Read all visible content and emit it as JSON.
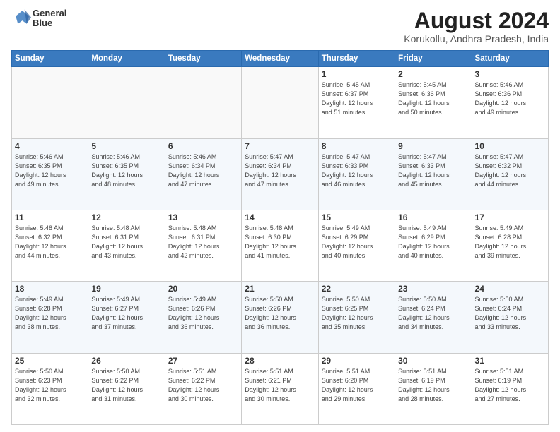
{
  "header": {
    "logo_line1": "General",
    "logo_line2": "Blue",
    "title": "August 2024",
    "subtitle": "Korukollu, Andhra Pradesh, India"
  },
  "calendar": {
    "headers": [
      "Sunday",
      "Monday",
      "Tuesday",
      "Wednesday",
      "Thursday",
      "Friday",
      "Saturday"
    ],
    "weeks": [
      [
        {
          "day": "",
          "info": "",
          "empty": true
        },
        {
          "day": "",
          "info": "",
          "empty": true
        },
        {
          "day": "",
          "info": "",
          "empty": true
        },
        {
          "day": "",
          "info": "",
          "empty": true
        },
        {
          "day": "1",
          "info": "Sunrise: 5:45 AM\nSunset: 6:37 PM\nDaylight: 12 hours\nand 51 minutes."
        },
        {
          "day": "2",
          "info": "Sunrise: 5:45 AM\nSunset: 6:36 PM\nDaylight: 12 hours\nand 50 minutes."
        },
        {
          "day": "3",
          "info": "Sunrise: 5:46 AM\nSunset: 6:36 PM\nDaylight: 12 hours\nand 49 minutes."
        }
      ],
      [
        {
          "day": "4",
          "info": "Sunrise: 5:46 AM\nSunset: 6:35 PM\nDaylight: 12 hours\nand 49 minutes."
        },
        {
          "day": "5",
          "info": "Sunrise: 5:46 AM\nSunset: 6:35 PM\nDaylight: 12 hours\nand 48 minutes."
        },
        {
          "day": "6",
          "info": "Sunrise: 5:46 AM\nSunset: 6:34 PM\nDaylight: 12 hours\nand 47 minutes."
        },
        {
          "day": "7",
          "info": "Sunrise: 5:47 AM\nSunset: 6:34 PM\nDaylight: 12 hours\nand 47 minutes."
        },
        {
          "day": "8",
          "info": "Sunrise: 5:47 AM\nSunset: 6:33 PM\nDaylight: 12 hours\nand 46 minutes."
        },
        {
          "day": "9",
          "info": "Sunrise: 5:47 AM\nSunset: 6:33 PM\nDaylight: 12 hours\nand 45 minutes."
        },
        {
          "day": "10",
          "info": "Sunrise: 5:47 AM\nSunset: 6:32 PM\nDaylight: 12 hours\nand 44 minutes."
        }
      ],
      [
        {
          "day": "11",
          "info": "Sunrise: 5:48 AM\nSunset: 6:32 PM\nDaylight: 12 hours\nand 44 minutes."
        },
        {
          "day": "12",
          "info": "Sunrise: 5:48 AM\nSunset: 6:31 PM\nDaylight: 12 hours\nand 43 minutes."
        },
        {
          "day": "13",
          "info": "Sunrise: 5:48 AM\nSunset: 6:31 PM\nDaylight: 12 hours\nand 42 minutes."
        },
        {
          "day": "14",
          "info": "Sunrise: 5:48 AM\nSunset: 6:30 PM\nDaylight: 12 hours\nand 41 minutes."
        },
        {
          "day": "15",
          "info": "Sunrise: 5:49 AM\nSunset: 6:29 PM\nDaylight: 12 hours\nand 40 minutes."
        },
        {
          "day": "16",
          "info": "Sunrise: 5:49 AM\nSunset: 6:29 PM\nDaylight: 12 hours\nand 40 minutes."
        },
        {
          "day": "17",
          "info": "Sunrise: 5:49 AM\nSunset: 6:28 PM\nDaylight: 12 hours\nand 39 minutes."
        }
      ],
      [
        {
          "day": "18",
          "info": "Sunrise: 5:49 AM\nSunset: 6:28 PM\nDaylight: 12 hours\nand 38 minutes."
        },
        {
          "day": "19",
          "info": "Sunrise: 5:49 AM\nSunset: 6:27 PM\nDaylight: 12 hours\nand 37 minutes."
        },
        {
          "day": "20",
          "info": "Sunrise: 5:49 AM\nSunset: 6:26 PM\nDaylight: 12 hours\nand 36 minutes."
        },
        {
          "day": "21",
          "info": "Sunrise: 5:50 AM\nSunset: 6:26 PM\nDaylight: 12 hours\nand 36 minutes."
        },
        {
          "day": "22",
          "info": "Sunrise: 5:50 AM\nSunset: 6:25 PM\nDaylight: 12 hours\nand 35 minutes."
        },
        {
          "day": "23",
          "info": "Sunrise: 5:50 AM\nSunset: 6:24 PM\nDaylight: 12 hours\nand 34 minutes."
        },
        {
          "day": "24",
          "info": "Sunrise: 5:50 AM\nSunset: 6:24 PM\nDaylight: 12 hours\nand 33 minutes."
        }
      ],
      [
        {
          "day": "25",
          "info": "Sunrise: 5:50 AM\nSunset: 6:23 PM\nDaylight: 12 hours\nand 32 minutes."
        },
        {
          "day": "26",
          "info": "Sunrise: 5:50 AM\nSunset: 6:22 PM\nDaylight: 12 hours\nand 31 minutes."
        },
        {
          "day": "27",
          "info": "Sunrise: 5:51 AM\nSunset: 6:22 PM\nDaylight: 12 hours\nand 30 minutes."
        },
        {
          "day": "28",
          "info": "Sunrise: 5:51 AM\nSunset: 6:21 PM\nDaylight: 12 hours\nand 30 minutes."
        },
        {
          "day": "29",
          "info": "Sunrise: 5:51 AM\nSunset: 6:20 PM\nDaylight: 12 hours\nand 29 minutes."
        },
        {
          "day": "30",
          "info": "Sunrise: 5:51 AM\nSunset: 6:19 PM\nDaylight: 12 hours\nand 28 minutes."
        },
        {
          "day": "31",
          "info": "Sunrise: 5:51 AM\nSunset: 6:19 PM\nDaylight: 12 hours\nand 27 minutes."
        }
      ]
    ]
  }
}
